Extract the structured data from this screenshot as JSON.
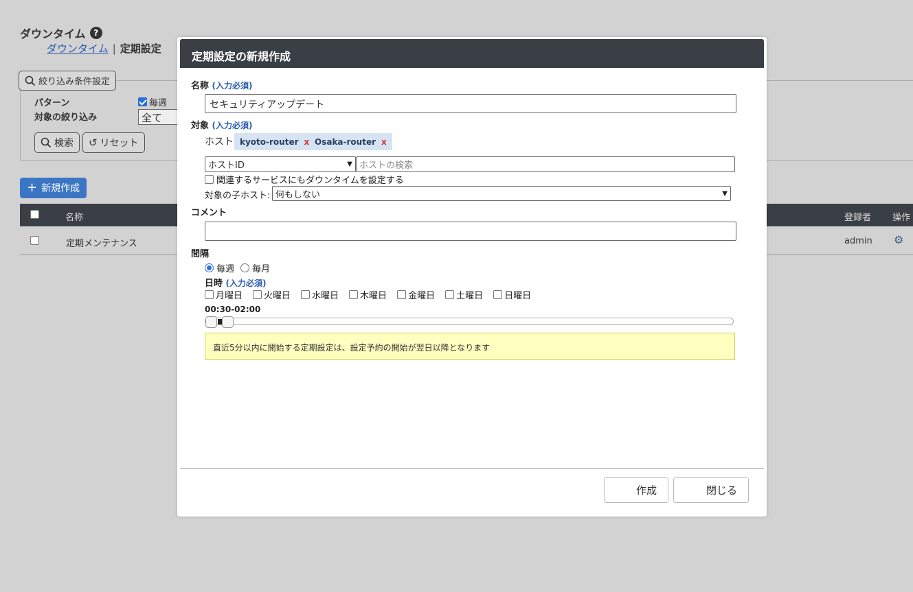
{
  "page": {
    "title": "ダウンタイム",
    "help_icon": "?",
    "breadcrumb": {
      "link": "ダウンタイム",
      "separator": "|",
      "current": "定期設定"
    }
  },
  "filter": {
    "toggle_label": "絞り込み条件設定",
    "pattern_label": "パターン",
    "pattern_weekly": "毎週",
    "target_label": "対象の絞り込み",
    "target_value": "全て",
    "search_label": "検索",
    "reset_label": "リセット"
  },
  "new_button": "新規作成",
  "table": {
    "headers": {
      "name": "名称",
      "registrant": "登録者",
      "operation": "操作"
    },
    "rows": [
      {
        "name": "定期メンテナンス",
        "registrant": "admin"
      }
    ]
  },
  "modal": {
    "title": "定期設定の新規作成",
    "required": "(入力必須)",
    "name_label": "名称",
    "name_value": "セキュリティアップデート",
    "target_label": "対象",
    "host_label": "ホスト:",
    "hosts": [
      {
        "name": "kyoto-router",
        "remove": "x"
      },
      {
        "name": "Osaka-router",
        "remove": "x"
      }
    ],
    "host_select_value": "ホストID",
    "host_search_placeholder": "ホストの検索",
    "related_services_label": "関連するサービスにもダウンタイムを設定する",
    "child_host_label": "対象の子ホスト:",
    "child_host_value": "何もしない",
    "comment_label": "コメント",
    "comment_value": "",
    "interval_label": "間隔",
    "interval_weekly": "毎週",
    "interval_monthly": "毎月",
    "interval_selected": "weekly",
    "datetime_label": "日時",
    "days": [
      "月曜日",
      "火曜日",
      "水曜日",
      "木曜日",
      "金曜日",
      "土曜日",
      "日曜日"
    ],
    "time_range": "00:30-02:00",
    "notice": "直近5分以内に開始する定期設定は、設定予約の開始が翌日以降となります",
    "create_button": "作成",
    "close_button": "閉じる"
  }
}
